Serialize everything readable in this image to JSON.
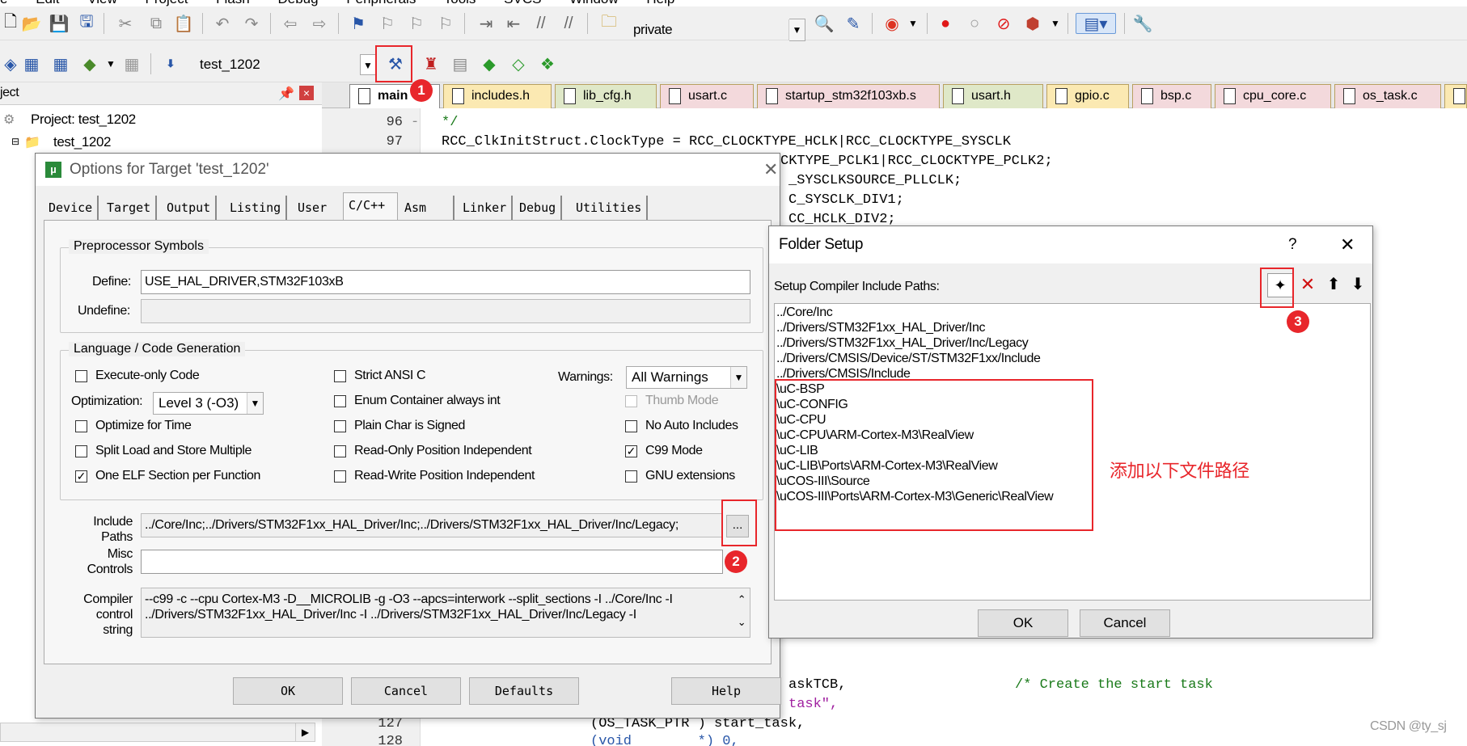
{
  "menubar": {
    "items": [
      "e",
      "Edit",
      "View",
      "Project",
      "Flash",
      "Debug",
      "Peripherals",
      "Tools",
      "SVCS",
      "Window",
      "Help"
    ]
  },
  "toolbar1": {
    "combo_value": "private"
  },
  "toolbar2": {
    "target_combo": "test_1202"
  },
  "project_pane": {
    "title": "ject",
    "pin_icon": "pin-icon",
    "close": "×",
    "root": "Project: test_1202",
    "target": "test_1202"
  },
  "file_tabs": [
    "main",
    "includes.h",
    "lib_cfg.h",
    "usart.c",
    "startup_stm32f103xb.s",
    "usart.h",
    "gpio.c",
    "bsp.c",
    "cpu_core.c",
    "os_task.c"
  ],
  "editor": {
    "lines_top": [
      {
        "num": "96",
        "code": "*/"
      },
      {
        "num": "97",
        "code": "RCC_ClkInitStruct.ClockType = RCC_CLOCKTYPE_HCLK|RCC_CLOCKTYPE_SYSCLK"
      }
    ],
    "visible_fragments": [
      "CKTYPE_PCLK1|RCC_CLOCKTYPE_PCLK2;",
      "_SYSCLKSOURCE_PLLCLK;",
      "C_SYSCLK_DIV1;",
      "CC_HCLK_DIV2;"
    ],
    "bottom_fragments": [
      "askTCB,",
      "/* Create the start task",
      "task\",",
      "(OS_TASK_PTR ) start_task,",
      "(void        *) 0,"
    ],
    "bottom_lines": [
      "127",
      "128"
    ]
  },
  "options_dialog": {
    "title": "Options for Target 'test_1202'",
    "tabs": [
      "Device",
      "Target",
      "Output",
      "Listing",
      "User",
      "C/C++",
      "Asm",
      "Linker",
      "Debug",
      "Utilities"
    ],
    "preproc_group": "Preprocessor Symbols",
    "define_label": "Define:",
    "define_value": "USE_HAL_DRIVER,STM32F103xB",
    "undefine_label": "Undefine:",
    "undefine_value": "",
    "lang_group": "Language / Code Generation",
    "checkboxes": {
      "execute_only": {
        "label": "Execute-only Code",
        "checked": false
      },
      "optimize_time": {
        "label": "Optimize for Time",
        "checked": false
      },
      "split_load": {
        "label": "Split Load and Store Multiple",
        "checked": false
      },
      "one_elf": {
        "label": "One ELF Section per Function",
        "checked": true
      },
      "strict_ansi": {
        "label": "Strict ANSI C",
        "checked": false
      },
      "enum_int": {
        "label": "Enum Container always int",
        "checked": false
      },
      "plain_char": {
        "label": "Plain Char is Signed",
        "checked": false
      },
      "ro_pi": {
        "label": "Read-Only Position Independent",
        "checked": false
      },
      "rw_pi": {
        "label": "Read-Write Position Independent",
        "checked": false
      },
      "thumb_mode": {
        "label": "Thumb Mode",
        "checked": false
      },
      "no_auto_inc": {
        "label": "No Auto Includes",
        "checked": false
      },
      "c99": {
        "label": "C99 Mode",
        "checked": true
      },
      "gnu_ext": {
        "label": "GNU extensions",
        "checked": false
      }
    },
    "optimization_label": "Optimization:",
    "optimization_value": "Level 3 (-O3)",
    "warnings_label": "Warnings:",
    "warnings_value": "All Warnings",
    "include_label": "Include\nPaths",
    "include_value": "../Core/Inc;../Drivers/STM32F1xx_HAL_Driver/Inc;../Drivers/STM32F1xx_HAL_Driver/Inc/Legacy;",
    "browse_label": "...",
    "misc_label": "Misc\nControls",
    "misc_value": "",
    "compiler_label": "Compiler\ncontrol\nstring",
    "compiler_line1": "--c99 -c --cpu Cortex-M3 -D__MICROLIB -g -O3 --apcs=interwork --split_sections -I ../Core/Inc -I",
    "compiler_line2": "../Drivers/STM32F1xx_HAL_Driver/Inc -I ../Drivers/STM32F1xx_HAL_Driver/Inc/Legacy -I",
    "buttons": {
      "ok": "OK",
      "cancel": "Cancel",
      "defaults": "Defaults",
      "help": "Help"
    }
  },
  "folder_dialog": {
    "title": "Folder Setup",
    "help": "?",
    "close": "✕",
    "header": "Setup Compiler Include Paths:",
    "paths": [
      "../Core/Inc",
      "../Drivers/STM32F1xx_HAL_Driver/Inc",
      "../Drivers/STM32F1xx_HAL_Driver/Inc/Legacy",
      "../Drivers/CMSIS/Device/ST/STM32F1xx/Include",
      "../Drivers/CMSIS/Include",
      "\\uC-BSP",
      "\\uC-CONFIG",
      "\\uC-CPU",
      "\\uC-CPU\\ARM-Cortex-M3\\RealView",
      "\\uC-LIB",
      "\\uC-LIB\\Ports\\ARM-Cortex-M3\\RealView",
      "\\uCOS-III\\Source",
      "\\uCOS-III\\Ports\\ARM-Cortex-M3\\Generic\\RealView"
    ],
    "ok": "OK",
    "cancel": "Cancel"
  },
  "annotations": {
    "badge1": "1",
    "badge2": "2",
    "badge3": "3",
    "note": "添加以下文件路径",
    "note_color": "#e8262b"
  },
  "watermark": "CSDN @ty_sj"
}
